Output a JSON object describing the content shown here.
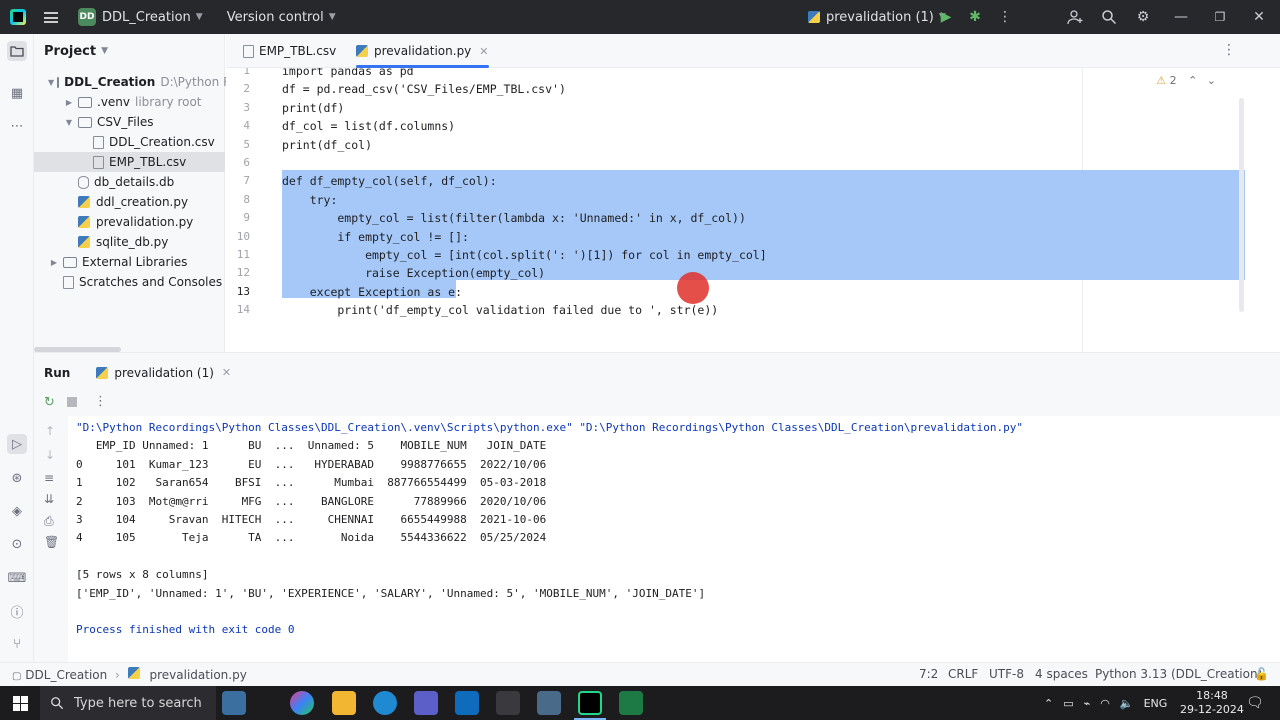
{
  "titlebar": {
    "project_badge": "DD",
    "project_name": "DDL_Creation",
    "version_control": "Version control",
    "run_config": "prevalidation (1)"
  },
  "project_panel": {
    "title": "Project",
    "items": [
      {
        "label": "DDL_Creation",
        "hint": "D:\\Python R",
        "kind": "folder",
        "expanded": true,
        "level": 0
      },
      {
        "label": ".venv",
        "hint": "library root",
        "kind": "folder",
        "expanded": false,
        "level": 1
      },
      {
        "label": "CSV_Files",
        "hint": "",
        "kind": "folder",
        "expanded": true,
        "level": 1
      },
      {
        "label": "DDL_Creation.csv",
        "hint": "",
        "kind": "csv",
        "level": 2
      },
      {
        "label": "EMP_TBL.csv",
        "hint": "",
        "kind": "csv",
        "level": 2,
        "selected": true
      },
      {
        "label": "db_details.db",
        "hint": "",
        "kind": "db",
        "level": 1
      },
      {
        "label": "ddl_creation.py",
        "hint": "",
        "kind": "py",
        "level": 1
      },
      {
        "label": "prevalidation.py",
        "hint": "",
        "kind": "py",
        "level": 1
      },
      {
        "label": "sqlite_db.py",
        "hint": "",
        "kind": "py",
        "level": 1
      },
      {
        "label": "External Libraries",
        "hint": "",
        "kind": "lib",
        "level": 0
      },
      {
        "label": "Scratches and Consoles",
        "hint": "",
        "kind": "scratch",
        "level": 0
      }
    ]
  },
  "editor": {
    "tabs": [
      {
        "label": "EMP_TBL.csv",
        "active": false
      },
      {
        "label": "prevalidation.py",
        "active": true
      }
    ],
    "warnings": "2",
    "lines": [
      {
        "num": "1",
        "text": "import pandas as pd"
      },
      {
        "num": "2",
        "text": "df = pd.read_csv('CSV_Files/EMP_TBL.csv')"
      },
      {
        "num": "3",
        "text": "print(df)"
      },
      {
        "num": "4",
        "text": "df_col = list(df.columns)"
      },
      {
        "num": "5",
        "text": "print(df_col)"
      },
      {
        "num": "6",
        "text": ""
      },
      {
        "num": "7",
        "text": "def df_empty_col(self, df_col):"
      },
      {
        "num": "8",
        "text": "    try:"
      },
      {
        "num": "9",
        "text": "        empty_col = list(filter(lambda x: 'Unnamed:' in x, df_col))"
      },
      {
        "num": "10",
        "text": "        if empty_col != []:"
      },
      {
        "num": "11",
        "text": "            empty_col = [int(col.split(': ')[1]) for col in empty_col]"
      },
      {
        "num": "12",
        "text": "            raise Exception(empty_col)"
      },
      {
        "num": "13",
        "text": "    except Exception as e:"
      },
      {
        "num": "14",
        "text": "        print('df_empty_col validation failed due to ', str(e))"
      }
    ]
  },
  "run_panel": {
    "title": "Run",
    "tab_label": "prevalidation (1)",
    "console": [
      "\"D:\\Python Recordings\\Python Classes\\DDL_Creation\\.venv\\Scripts\\python.exe\" \"D:\\Python Recordings\\Python Classes\\DDL_Creation\\prevalidation.py\"",
      "   EMP_ID Unnamed: 1      BU  ...  Unnamed: 5    MOBILE_NUM   JOIN_DATE",
      "0     101  Kumar_123      EU  ...   HYDERABAD    9988776655  2022/10/06",
      "1     102   Saran654    BFSI  ...      Mumbai  887766554499  05-03-2018",
      "2     103  Mot@m@rri     MFG  ...    BANGLORE      77889966  2020/10/06",
      "3     104     Sravan  HITECH  ...     CHENNAI    6655449988  2021-10-06",
      "4     105       Teja      TA  ...       Noida    5544336622  05/25/2024",
      "",
      "[5 rows x 8 columns]",
      "['EMP_ID', 'Unnamed: 1', 'BU', 'EXPERIENCE', 'SALARY', 'Unnamed: 5', 'MOBILE_NUM', 'JOIN_DATE']",
      "",
      "Process finished with exit code 0"
    ]
  },
  "statusbar": {
    "breadcrumb_project": "DDL_Creation",
    "breadcrumb_file": "prevalidation.py",
    "position": "7:2",
    "line_sep": "CRLF",
    "encoding": "UTF-8",
    "indent": "4 spaces",
    "interpreter": "Python 3.13 (DDL_Creation)"
  },
  "taskbar": {
    "search_placeholder": "Type here to search",
    "lang": "ENG",
    "time": "18:48",
    "date": "29-12-2024"
  }
}
